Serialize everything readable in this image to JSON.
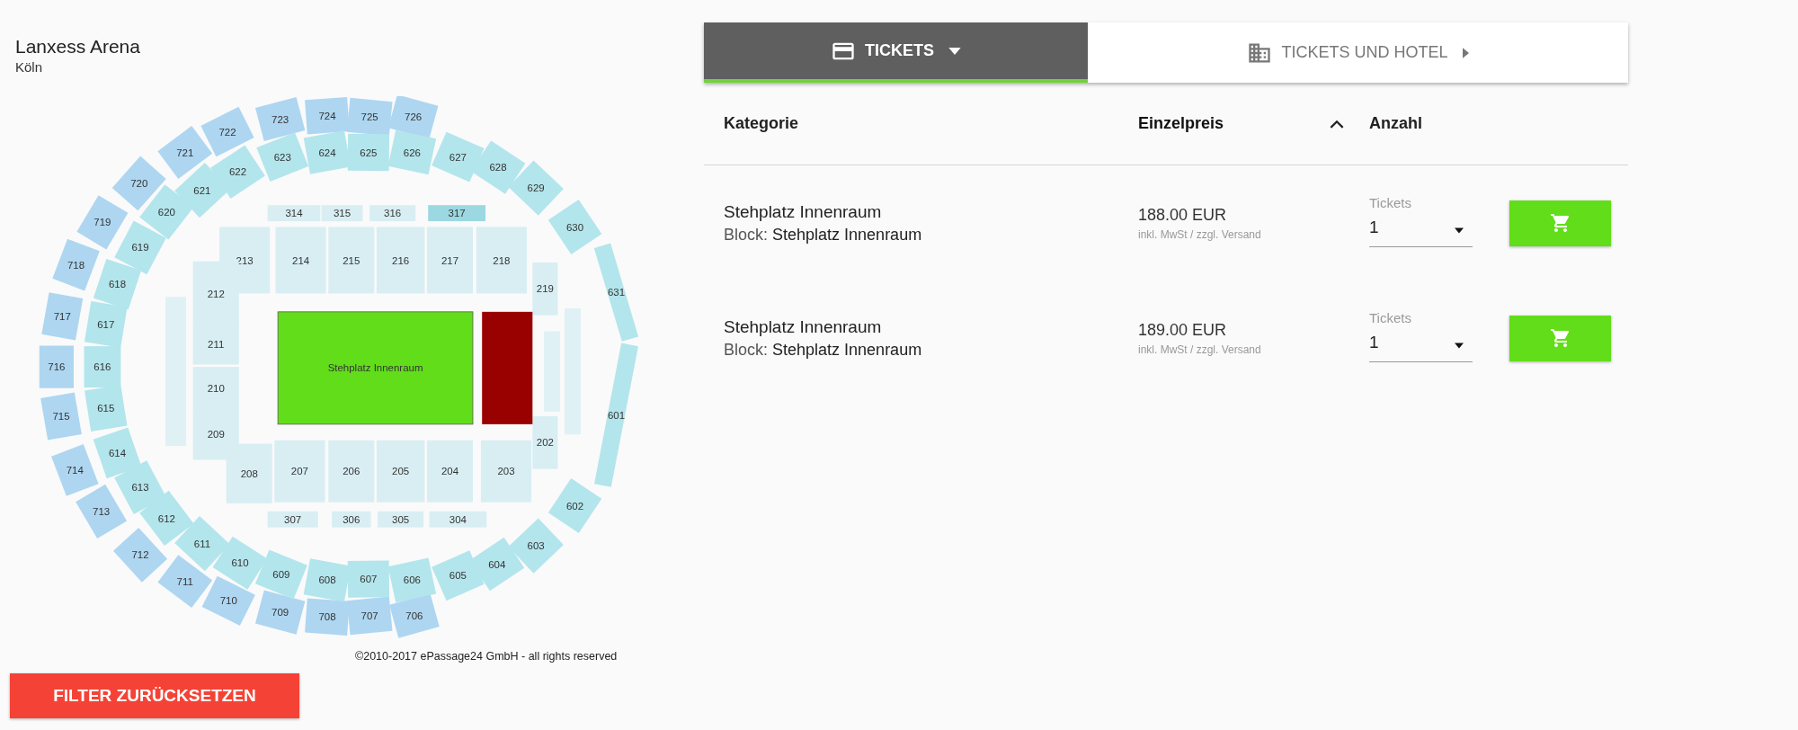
{
  "venue": {
    "name": "Lanxess Arena",
    "city": "Köln"
  },
  "seat_map": {
    "tiers": [
      {
        "kind": "outer-ring",
        "color": "#aed6f1",
        "sections": [
          {
            "label": "717"
          },
          {
            "label": "718"
          },
          {
            "label": "719"
          },
          {
            "label": "720"
          },
          {
            "label": "721"
          },
          {
            "label": "722"
          },
          {
            "label": "723"
          },
          {
            "label": "724"
          },
          {
            "label": "725"
          },
          {
            "label": "726"
          },
          {
            "label": "716"
          },
          {
            "label": "715"
          },
          {
            "label": "714"
          },
          {
            "label": "713"
          },
          {
            "label": "712"
          },
          {
            "label": "711"
          },
          {
            "label": "710"
          },
          {
            "label": "709"
          },
          {
            "label": "708"
          },
          {
            "label": "707"
          },
          {
            "label": "706"
          }
        ]
      },
      {
        "kind": "inner-ring",
        "color": "#b3e5ec",
        "sections": [
          {
            "label": "617"
          },
          {
            "label": "618"
          },
          {
            "label": "619"
          },
          {
            "label": "620"
          },
          {
            "label": "621"
          },
          {
            "label": "622"
          },
          {
            "label": "623"
          },
          {
            "label": "624"
          },
          {
            "label": "625"
          },
          {
            "label": "626"
          },
          {
            "label": "627"
          },
          {
            "label": "628"
          },
          {
            "label": "629"
          },
          {
            "label": "630"
          },
          {
            "label": "631"
          },
          {
            "label": "616"
          },
          {
            "label": "615"
          },
          {
            "label": "614"
          },
          {
            "label": "613"
          },
          {
            "label": "612"
          },
          {
            "label": "611"
          },
          {
            "label": "610"
          },
          {
            "label": "609"
          },
          {
            "label": "608"
          },
          {
            "label": "607"
          },
          {
            "label": "606"
          },
          {
            "label": "605"
          },
          {
            "label": "604"
          },
          {
            "label": "603"
          },
          {
            "label": "602"
          },
          {
            "label": "601"
          }
        ]
      },
      {
        "kind": "upper-row",
        "color": "#d8eef3",
        "sections": [
          {
            "label": "314"
          },
          {
            "label": "315"
          },
          {
            "label": "316"
          },
          {
            "label": "317",
            "color": "#9bd8e2"
          },
          {
            "label": "307"
          },
          {
            "label": "306"
          },
          {
            "label": "305"
          },
          {
            "label": "304"
          }
        ]
      },
      {
        "kind": "block",
        "color": "#d8eef3",
        "sections": [
          {
            "label": "213"
          },
          {
            "label": "214"
          },
          {
            "label": "215"
          },
          {
            "label": "216"
          },
          {
            "label": "217"
          },
          {
            "label": "218"
          },
          {
            "label": "219"
          },
          {
            "label": "212"
          },
          {
            "label": "211"
          },
          {
            "label": "210"
          },
          {
            "label": "209"
          },
          {
            "label": "208"
          },
          {
            "label": "207"
          },
          {
            "label": "206"
          },
          {
            "label": "205"
          },
          {
            "label": "204"
          },
          {
            "label": "203"
          },
          {
            "label": "202"
          }
        ]
      }
    ],
    "areas": [
      {
        "label": "Stehplatz Innenraum",
        "color": "#62dd1a"
      },
      {
        "color": "#990000"
      }
    ]
  },
  "copyright": "©2010-2017 ePassage24 GmbH - all rights reserved",
  "reset_button": "FILTER ZURÜCKSETZEN",
  "tabs": [
    {
      "label": "TICKETS",
      "selected": true
    },
    {
      "label": "TICKETS UND HOTEL",
      "selected": false
    }
  ],
  "table": {
    "columns": [
      {
        "label": "Kategorie",
        "sorted": false
      },
      {
        "label": "Einzelpreis",
        "sorted": true
      },
      {
        "label": "Anzahl",
        "sorted": false
      }
    ],
    "rows": [
      {
        "category": "Stehplatz Innenraum",
        "block": "Block: **Stehplatz Innenraum**",
        "price": "188.00 EUR",
        "price_note": "inkl. MwSt / zzgl. Versand",
        "quantity": {
          "label": "Tickets",
          "value": "1"
        }
      },
      {
        "category": "Stehplatz Innenraum",
        "block": "Block: **Stehplatz Innenraum**",
        "price": "189.00 EUR",
        "price_note": "inkl. MwSt / zzgl. Versand",
        "quantity": {
          "label": "Tickets",
          "value": "1"
        }
      }
    ]
  }
}
